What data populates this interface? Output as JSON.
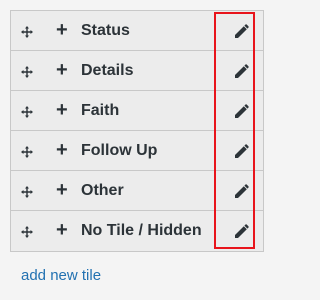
{
  "tiles": [
    {
      "label": "Status"
    },
    {
      "label": "Details"
    },
    {
      "label": "Faith"
    },
    {
      "label": "Follow Up"
    },
    {
      "label": "Other"
    },
    {
      "label": "No Tile / Hidden"
    }
  ],
  "expand_symbol": "+",
  "add_new_tile_label": "add new tile",
  "icons": {
    "move": "move-icon",
    "edit": "pencil-icon"
  },
  "colors": {
    "highlight": "#e8141b",
    "link": "#2271b1",
    "text": "#2c3338"
  }
}
